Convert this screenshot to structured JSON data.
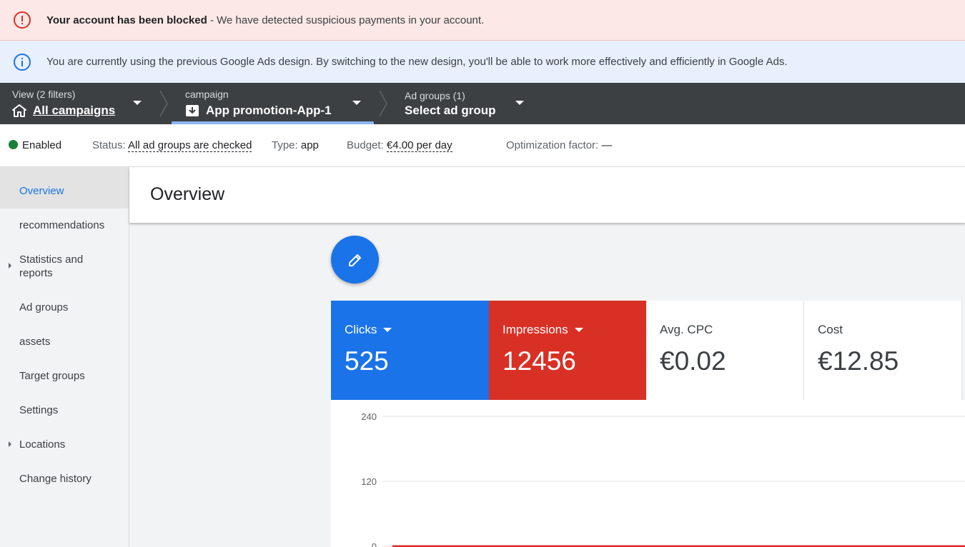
{
  "alerts": {
    "error": {
      "bold": "Your account has been blocked",
      "rest": " - We have detected suspicious payments in your account."
    },
    "info": {
      "text": "You are currently using the previous Google Ads design. By switching to the new design, you'll be able to work more effectively and efficiently in Google Ads."
    }
  },
  "breadcrumbs": [
    {
      "small": "View (2 filters)",
      "label": "All campaigns",
      "icon": "home-icon"
    },
    {
      "small": "campaign",
      "label": "App promotion-App-1",
      "icon": "app-download-icon"
    },
    {
      "small": "Ad groups (1)",
      "label": "Select ad group"
    }
  ],
  "status_bar": {
    "state": "Enabled",
    "status_label": "Status:",
    "status_value": "All ad groups are checked",
    "type_label": "Type:",
    "type_value": "app",
    "budget_label": "Budget:",
    "budget_value": "€4.00 per day",
    "optimization_label": "Optimization factor:",
    "optimization_value": "—"
  },
  "sidebar": {
    "items": [
      {
        "label": "Overview",
        "active": true
      },
      {
        "label": "recommendations"
      },
      {
        "label": "Statistics and reports",
        "expandable": true
      },
      {
        "label": "Ad groups"
      },
      {
        "label": "assets"
      },
      {
        "label": "Target groups"
      },
      {
        "label": "Settings"
      },
      {
        "label": "Locations",
        "expandable": true
      },
      {
        "label": "Change history"
      }
    ]
  },
  "page": {
    "title": "Overview"
  },
  "scorecards": [
    {
      "label": "Clicks",
      "value": "525",
      "color": "#1a73e8",
      "dropdown": true
    },
    {
      "label": "Impressions",
      "value": "12456",
      "color": "#d93025",
      "dropdown": true
    },
    {
      "label": "Avg. CPC",
      "value": "€0.02"
    },
    {
      "label": "Cost",
      "value": "€12.85"
    }
  ],
  "colors": {
    "accent": "#1a73e8",
    "danger": "#d93025",
    "success": "#188038",
    "navbar": "#3c4043"
  },
  "chart_data": {
    "type": "line",
    "yticks": [
      "240",
      "120",
      "0"
    ],
    "ylim": [
      0,
      240
    ],
    "series": [
      {
        "values": [
          0,
          0
        ],
        "color": "#d93025"
      }
    ]
  }
}
